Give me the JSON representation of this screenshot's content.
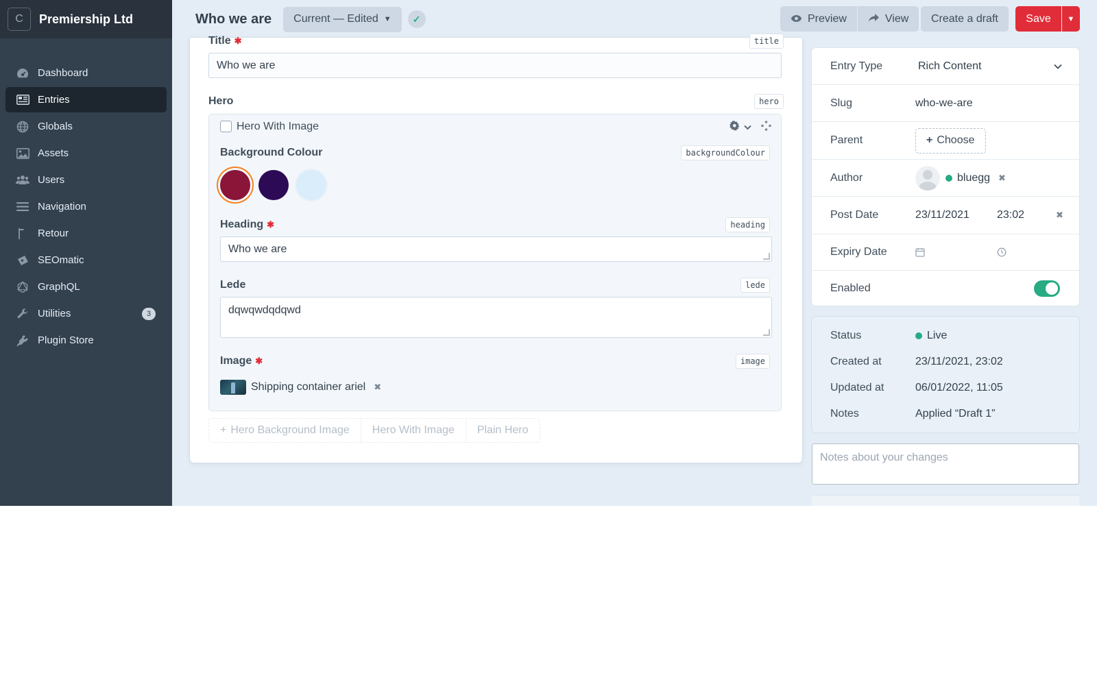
{
  "site": {
    "logo_letter": "C",
    "name": "Premiership Ltd"
  },
  "sidebar": {
    "items": [
      {
        "label": "Dashboard",
        "icon": "dashboard-icon"
      },
      {
        "label": "Entries",
        "icon": "entries-icon",
        "active": true
      },
      {
        "label": "Globals",
        "icon": "globe-icon"
      },
      {
        "label": "Assets",
        "icon": "image-icon"
      },
      {
        "label": "Users",
        "icon": "users-icon"
      },
      {
        "label": "Navigation",
        "icon": "bars-icon"
      },
      {
        "label": "Retour",
        "icon": "flag-icon"
      },
      {
        "label": "SEOmatic",
        "icon": "ticket-icon"
      },
      {
        "label": "GraphQL",
        "icon": "graphql-icon"
      },
      {
        "label": "Utilities",
        "icon": "wrench-icon",
        "badge": "3"
      },
      {
        "label": "Plugin Store",
        "icon": "plug-icon"
      }
    ]
  },
  "header": {
    "title": "Who we are",
    "revision": "Current — Edited",
    "preview_label": "Preview",
    "view_label": "View",
    "draft_label": "Create a draft",
    "save_label": "Save"
  },
  "fields": {
    "title": {
      "label": "Title",
      "handle": "title",
      "value": "Who we are"
    },
    "hero": {
      "label": "Hero",
      "handle": "hero",
      "block_type": "Hero With Image",
      "background_colour": {
        "label": "Background Colour",
        "handle": "backgroundColour",
        "swatches": [
          "#8a1538",
          "#2d0a55",
          "#d9edfb"
        ],
        "selected_index": 0,
        "selected_ring": "#f6801f"
      },
      "heading": {
        "label": "Heading",
        "handle": "heading",
        "value": "Who we are"
      },
      "lede": {
        "label": "Lede",
        "handle": "lede",
        "value": "dqwqwdqdqwd"
      },
      "image": {
        "label": "Image",
        "handle": "image",
        "asset": "Shipping container ariel"
      },
      "add_buttons": [
        "Hero Background Image",
        "Hero With Image",
        "Plain Hero"
      ]
    }
  },
  "meta": {
    "entry_type": {
      "label": "Entry Type",
      "value": "Rich Content"
    },
    "slug": {
      "label": "Slug",
      "value": "who-we-are"
    },
    "parent": {
      "label": "Parent",
      "button": "Choose"
    },
    "author": {
      "label": "Author",
      "value": "bluegg"
    },
    "post_date": {
      "label": "Post Date",
      "date": "23/11/2021",
      "time": "23:02"
    },
    "expiry_date": {
      "label": "Expiry Date"
    },
    "enabled": {
      "label": "Enabled",
      "on": true
    }
  },
  "status": {
    "status": {
      "label": "Status",
      "value": "Live"
    },
    "created": {
      "label": "Created at",
      "value": "23/11/2021, 23:02"
    },
    "updated": {
      "label": "Updated at",
      "value": "06/01/2022, 11:05"
    },
    "notes": {
      "label": "Notes",
      "value": "Applied “Draft 1”"
    }
  },
  "notes_input": {
    "placeholder": "Notes about your changes"
  },
  "colors": {
    "accent_red": "#e12d39",
    "live_green": "#27ab83",
    "sidebar": "#33404d"
  }
}
